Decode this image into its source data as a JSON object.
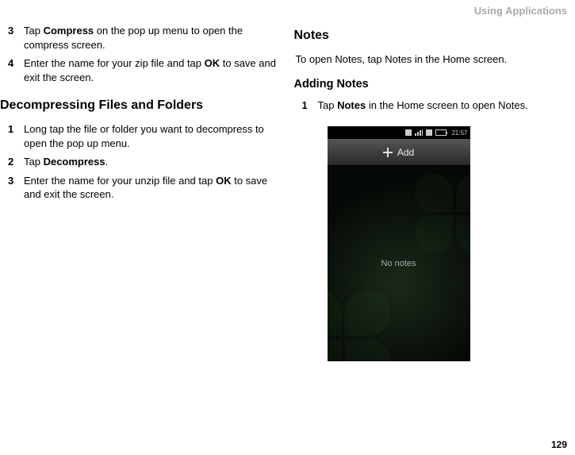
{
  "header": {
    "section_label": "Using Applications"
  },
  "left_column": {
    "steps_a": [
      {
        "num": "3",
        "prefix": "Tap ",
        "bold": "Compress",
        "suffix": " on the pop up menu to open the compress screen."
      },
      {
        "num": "4",
        "prefix": "Enter the name for your zip file and tap ",
        "bold": "OK",
        "suffix": " to save and exit the screen."
      }
    ],
    "heading_decomp": "Decompressing Files and Folders",
    "steps_b": [
      {
        "num": "1",
        "prefix": "Long tap the file or folder you want to decompress to open the pop up menu.",
        "bold": "",
        "suffix": ""
      },
      {
        "num": "2",
        "prefix": "Tap ",
        "bold": "Decompress",
        "suffix": "."
      },
      {
        "num": "3",
        "prefix": "Enter the name for your unzip file and tap ",
        "bold": "OK",
        "suffix": " to save and exit the screen."
      }
    ]
  },
  "right_column": {
    "heading_notes": "Notes",
    "open_notes": {
      "prefix": "To open Notes, tap ",
      "bold": "Notes",
      "suffix": " in the Home screen."
    },
    "heading_adding": "Adding Notes",
    "steps_c": [
      {
        "num": "1",
        "prefix": "Tap ",
        "bold": "Notes",
        "suffix": " in the Home screen to open Notes."
      }
    ]
  },
  "phone": {
    "time": "21:57",
    "toolbar_label": "Add",
    "body_text": "No notes"
  },
  "page_number": "129"
}
